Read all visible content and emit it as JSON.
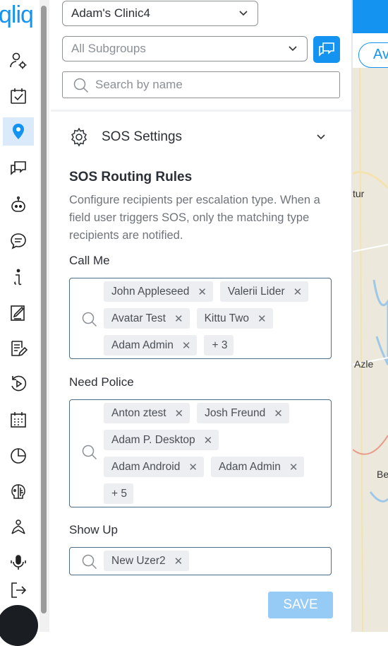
{
  "logo": "qliq",
  "nav": {
    "items": [
      {
        "name": "user-settings-icon"
      },
      {
        "name": "task-checklist-icon"
      },
      {
        "name": "location-pin-icon",
        "active": true
      },
      {
        "name": "chat-bubbles-icon"
      },
      {
        "name": "bot-icon"
      },
      {
        "name": "message-icon"
      },
      {
        "name": "info-icon"
      },
      {
        "name": "form-edit-icon"
      },
      {
        "name": "notes-edit-icon"
      },
      {
        "name": "replay-icon"
      },
      {
        "name": "calendar-icon"
      },
      {
        "name": "pie-chart-icon"
      },
      {
        "name": "ai-brain-icon"
      },
      {
        "name": "person-network-icon"
      },
      {
        "name": "microphone-icon"
      },
      {
        "name": "logout-icon"
      }
    ]
  },
  "filters": {
    "clinic": "Adam's Clinic4",
    "subgroups_placeholder": "All Subgroups",
    "search_placeholder": "Search by name"
  },
  "sos": {
    "header": "SOS Settings",
    "rules_title": "SOS Routing Rules",
    "rules_desc": "Configure recipients per escalation type. When a field user triggers SOS, only the matching type recipients are notified.",
    "groups": [
      {
        "label": "Call Me",
        "chips": [
          "John Appleseed",
          "Valerii Lider",
          "Avatar Test",
          "Kittu Two",
          "Adam Admin"
        ],
        "more": "+ 3"
      },
      {
        "label": "Need Police",
        "chips": [
          "Anton ztest",
          "Josh Freund",
          "Adam P. Desktop",
          "Adam Android",
          "Adam Admin"
        ],
        "more": "+ 5"
      },
      {
        "label": "Show Up",
        "chips": [
          "New Uzer2"
        ],
        "more": null
      }
    ],
    "save": "SAVE"
  },
  "map": {
    "button_partial": "Av",
    "labels": [
      "tur",
      "Azle",
      "Be"
    ]
  },
  "colors": {
    "accent": "#1493f0",
    "save_disabled": "#96cbf5",
    "chip_bg": "#eceef1"
  }
}
